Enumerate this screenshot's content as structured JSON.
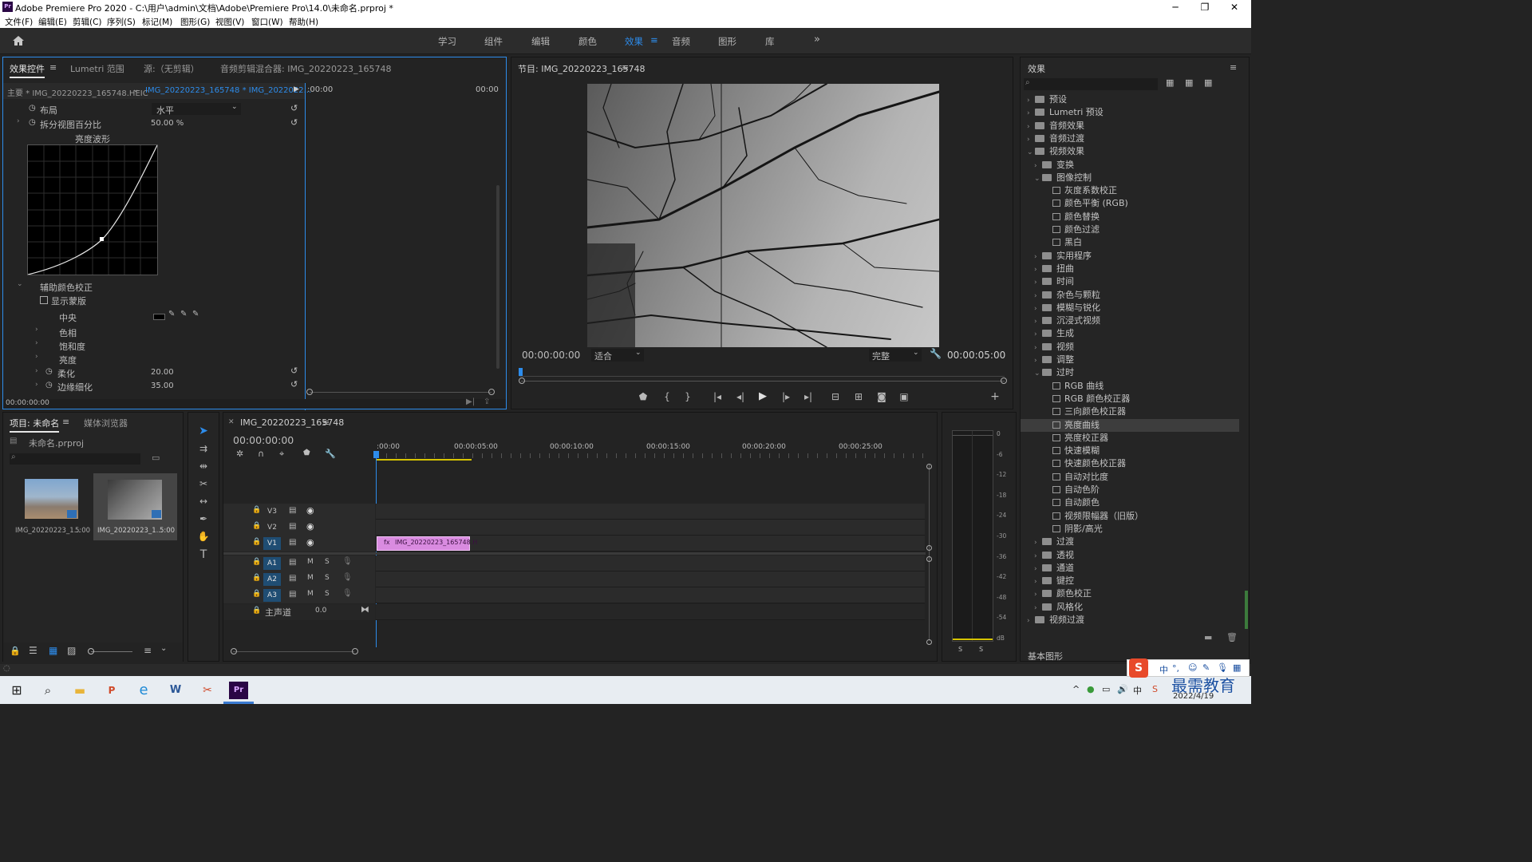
{
  "window": {
    "title": "Adobe Premiere Pro 2020 - C:\\用户\\admin\\文档\\Adobe\\Premiere Pro\\14.0\\未命名.prproj *",
    "app_badge": "Pr"
  },
  "menu": [
    "文件(F)",
    "编辑(E)",
    "剪辑(C)",
    "序列(S)",
    "标记(M)",
    "图形(G)",
    "视图(V)",
    "窗口(W)",
    "帮助(H)"
  ],
  "workspaces": [
    "学习",
    "组件",
    "编辑",
    "颜色",
    "效果",
    "音频",
    "图形",
    "库"
  ],
  "workspace_active": "效果",
  "effect_controls": {
    "tabs": [
      "效果控件",
      "Lumetri 范围",
      "源:（无剪辑）",
      "音频剪辑混合器: IMG_20220223_165748"
    ],
    "master": "主要 * IMG_20220223_165748.HEIC",
    "clip": "IMG_20220223_165748 * IMG_2022022...",
    "time_start": ":00:00",
    "time_end": "00:00",
    "layout_label": "布局",
    "layout_value": "水平",
    "split_label": "拆分视图百分比",
    "split_value": "50.00 %",
    "curve_title": "亮度波形",
    "secondary_label": "辅助颜色校正",
    "show_mask": "显示蒙版",
    "center": "中央",
    "hue": "色相",
    "saturation": "饱和度",
    "luma": "亮度",
    "soften_label": "柔化",
    "soften_value": "20.00",
    "edge_label": "边缘细化",
    "edge_value": "35.00",
    "timecode": "00:00:00:00"
  },
  "program": {
    "title": "节目: IMG_20220223_165748",
    "timecode": "00:00:00:00",
    "fit": "适合",
    "quality": "完整",
    "duration": "00:00:05:00"
  },
  "project": {
    "tabs": [
      "项目: 未命名",
      "媒体浏览器"
    ],
    "file": "未命名.prproj",
    "items": [
      {
        "name": "IMG_20220223_1...",
        "dur": "5:00"
      },
      {
        "name": "IMG_20220223_1...",
        "dur": "5:00"
      }
    ]
  },
  "timeline": {
    "tab": "IMG_20220223_165748",
    "timecode": "00:00:00:00",
    "ruler": [
      ":00:00",
      "00:00:05:00",
      "00:00:10:00",
      "00:00:15:00",
      "00:00:20:00",
      "00:00:25:00"
    ],
    "video_tracks": [
      "V3",
      "V2",
      "V1"
    ],
    "audio_tracks": [
      "A1",
      "A2",
      "A3"
    ],
    "master_label": "主声道",
    "master_value": "0.0",
    "clip": "IMG_20220223_165748.H",
    "mute": "M",
    "solo": "S"
  },
  "meter": {
    "scale": [
      "0",
      "-6",
      "-12",
      "-18",
      "-24",
      "-30",
      "-36",
      "-42",
      "-48",
      "-54",
      "dB"
    ],
    "solo": [
      "S",
      "S"
    ]
  },
  "effects": {
    "title": "效果",
    "tree": [
      {
        "label": "预设",
        "level": 0,
        "type": "folder",
        "open": false
      },
      {
        "label": "Lumetri 预设",
        "level": 0,
        "type": "folder",
        "open": false
      },
      {
        "label": "音频效果",
        "level": 0,
        "type": "folder",
        "open": false
      },
      {
        "label": "音频过渡",
        "level": 0,
        "type": "folder",
        "open": false
      },
      {
        "label": "视频效果",
        "level": 0,
        "type": "folder",
        "open": true
      },
      {
        "label": "变换",
        "level": 1,
        "type": "folder",
        "open": false
      },
      {
        "label": "图像控制",
        "level": 1,
        "type": "folder",
        "open": true
      },
      {
        "label": "灰度系数校正",
        "level": 2,
        "type": "fx"
      },
      {
        "label": "颜色平衡 (RGB)",
        "level": 2,
        "type": "fx"
      },
      {
        "label": "颜色替换",
        "level": 2,
        "type": "fx"
      },
      {
        "label": "颜色过滤",
        "level": 2,
        "type": "fx"
      },
      {
        "label": "黑白",
        "level": 2,
        "type": "fx"
      },
      {
        "label": "实用程序",
        "level": 1,
        "type": "folder",
        "open": false
      },
      {
        "label": "扭曲",
        "level": 1,
        "type": "folder",
        "open": false
      },
      {
        "label": "时间",
        "level": 1,
        "type": "folder",
        "open": false
      },
      {
        "label": "杂色与颗粒",
        "level": 1,
        "type": "folder",
        "open": false
      },
      {
        "label": "模糊与锐化",
        "level": 1,
        "type": "folder",
        "open": false
      },
      {
        "label": "沉浸式视频",
        "level": 1,
        "type": "folder",
        "open": false
      },
      {
        "label": "生成",
        "level": 1,
        "type": "folder",
        "open": false
      },
      {
        "label": "视频",
        "level": 1,
        "type": "folder",
        "open": false
      },
      {
        "label": "调整",
        "level": 1,
        "type": "folder",
        "open": false
      },
      {
        "label": "过时",
        "level": 1,
        "type": "folder",
        "open": true
      },
      {
        "label": "RGB 曲线",
        "level": 2,
        "type": "fx"
      },
      {
        "label": "RGB 颜色校正器",
        "level": 2,
        "type": "fx"
      },
      {
        "label": "三向颜色校正器",
        "level": 2,
        "type": "fx"
      },
      {
        "label": "亮度曲线",
        "level": 2,
        "type": "fx",
        "selected": true
      },
      {
        "label": "亮度校正器",
        "level": 2,
        "type": "fx"
      },
      {
        "label": "快速模糊",
        "level": 2,
        "type": "fx"
      },
      {
        "label": "快速颜色校正器",
        "level": 2,
        "type": "fx"
      },
      {
        "label": "自动对比度",
        "level": 2,
        "type": "fx"
      },
      {
        "label": "自动色阶",
        "level": 2,
        "type": "fx"
      },
      {
        "label": "自动颜色",
        "level": 2,
        "type": "fx"
      },
      {
        "label": "视频限幅器（旧版）",
        "level": 2,
        "type": "fx"
      },
      {
        "label": "阴影/高光",
        "level": 2,
        "type": "fx"
      },
      {
        "label": "过渡",
        "level": 1,
        "type": "folder",
        "open": false
      },
      {
        "label": "透视",
        "level": 1,
        "type": "folder",
        "open": false
      },
      {
        "label": "通道",
        "level": 1,
        "type": "folder",
        "open": false
      },
      {
        "label": "键控",
        "level": 1,
        "type": "folder",
        "open": false
      },
      {
        "label": "颜色校正",
        "level": 1,
        "type": "folder",
        "open": false
      },
      {
        "label": "风格化",
        "level": 1,
        "type": "folder",
        "open": false
      },
      {
        "label": "视频过渡",
        "level": 0,
        "type": "folder",
        "open": false
      }
    ],
    "bottom": "基本图形"
  },
  "taskbar": {
    "ime": "中",
    "date": "2022/4/19",
    "watermark": "最需教育"
  }
}
